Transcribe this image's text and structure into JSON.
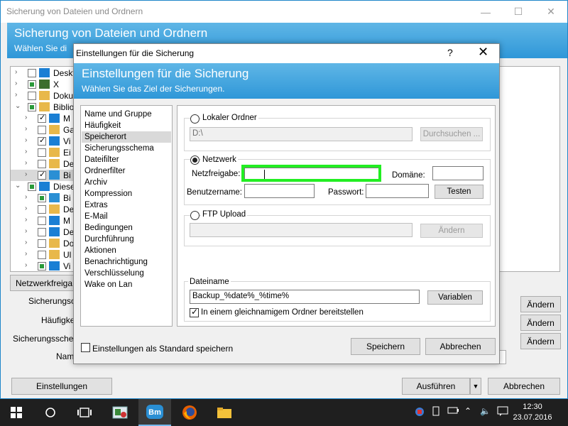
{
  "main": {
    "title": "Sicherung von Dateien und Ordnern",
    "header_title": "Sicherung von Dateien und Ordnern",
    "header_subtitle": "Wählen Sie di",
    "tree": [
      {
        "label": "Deskt",
        "indent": 0,
        "state": "none",
        "icon": "desktop-icon"
      },
      {
        "label": "X",
        "indent": 0,
        "state": "partial",
        "icon": "user-icon"
      },
      {
        "label": "Dokur",
        "indent": 0,
        "state": "none",
        "icon": "folder-icon"
      },
      {
        "label": "Bibliot",
        "indent": 0,
        "state": "partial",
        "icon": "library-icon",
        "expanded": true
      },
      {
        "label": "M",
        "indent": 1,
        "state": "checked",
        "icon": "music-icon"
      },
      {
        "label": "Ga",
        "indent": 1,
        "state": "none",
        "icon": "folder-icon"
      },
      {
        "label": "Vi",
        "indent": 1,
        "state": "checked",
        "icon": "video-icon"
      },
      {
        "label": "Ei",
        "indent": 1,
        "state": "none",
        "icon": "folder-icon"
      },
      {
        "label": "De",
        "indent": 1,
        "state": "none",
        "icon": "folder-icon"
      },
      {
        "label": "Bi",
        "indent": 1,
        "state": "checked",
        "icon": "pictures-icon",
        "selected": true
      },
      {
        "label": "Dieser",
        "indent": 0,
        "state": "partial",
        "icon": "computer-icon",
        "expanded": true
      },
      {
        "label": "Bi",
        "indent": 1,
        "state": "partial",
        "icon": "pictures-icon"
      },
      {
        "label": "De",
        "indent": 1,
        "state": "none",
        "icon": "folder-icon"
      },
      {
        "label": "M",
        "indent": 1,
        "state": "none",
        "icon": "music-icon"
      },
      {
        "label": "De",
        "indent": 1,
        "state": "none",
        "icon": "desktop-icon"
      },
      {
        "label": "Do",
        "indent": 1,
        "state": "none",
        "icon": "folder-icon"
      },
      {
        "label": "Ul",
        "indent": 1,
        "state": "none",
        "icon": "folder-icon"
      },
      {
        "label": "Vi",
        "indent": 1,
        "state": "partial",
        "icon": "video-icon"
      }
    ],
    "network_share_btn": "Netzwerkfreiga",
    "labels": {
      "sicherungsort": "Sicherungsor",
      "haeufigkeit": "Häufigkei",
      "sicherungsschema": "Sicherungsschema",
      "name": "Nam"
    },
    "aendern": "Ändern",
    "einstellungen_btn": "Einstellungen",
    "ausfuehren_btn": "Ausführen",
    "abbrechen_btn": "Abbrechen"
  },
  "dialog": {
    "title": "Einstellungen für die Sicherung",
    "help": "?",
    "close": "✕",
    "header_title": "Einstellungen für die Sicherung",
    "header_subtitle": "Wählen Sie das Ziel der Sicherungen.",
    "nav": [
      "Name und Gruppe",
      "Häufigkeit",
      "Speicherort",
      "Sicherungsschema",
      "Dateifilter",
      "Ordnerfilter",
      "Archiv",
      "Kompression",
      "Extras",
      "E-Mail",
      "Bedingungen",
      "Durchführung",
      "Aktionen",
      "Benachrichtigung",
      "Verschlüsselung",
      "Wake on Lan"
    ],
    "nav_active": 2,
    "local": {
      "label": "Lokaler Ordner",
      "path": "D:\\",
      "browse": "Durchsuchen ..."
    },
    "network": {
      "label": "Netzwerk",
      "share_label": "Netzfreigabe:",
      "share_value": "",
      "domain_label": "Domäne:",
      "domain_value": "",
      "user_label": "Benutzername:",
      "user_value": "",
      "password_label": "Passwort:",
      "password_value": "",
      "test": "Testen"
    },
    "ftp": {
      "label": "FTP Upload",
      "value": "",
      "change": "Ändern"
    },
    "filename": {
      "group_label": "Dateiname",
      "value": "Backup_%date%_%time%",
      "variables": "Variablen",
      "same_folder_label": "In einem gleichnamigem Ordner bereitstellen"
    },
    "default_checkbox": "Einstellungen als Standard speichern",
    "save": "Speichern",
    "cancel": "Abbrechen"
  },
  "taskbar": {
    "time": "12:30",
    "date": "23.07.2016"
  }
}
